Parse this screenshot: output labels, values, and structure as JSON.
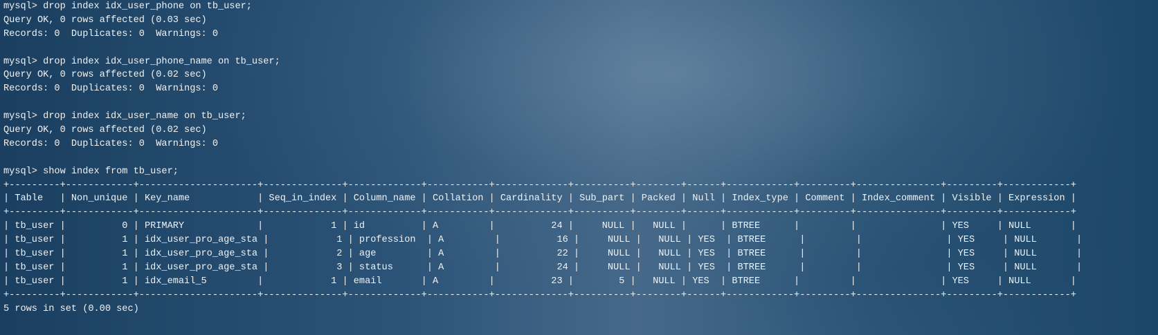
{
  "terminal": {
    "lines": [
      "mysql> drop index idx_user_phone on tb_user;",
      "Query OK, 0 rows affected (0.03 sec)",
      "Records: 0  Duplicates: 0  Warnings: 0",
      "",
      "mysql> drop index idx_user_phone_name on tb_user;",
      "Query OK, 0 rows affected (0.02 sec)",
      "Records: 0  Duplicates: 0  Warnings: 0",
      "",
      "mysql> drop index idx_user_name on tb_user;",
      "Query OK, 0 rows affected (0.02 sec)",
      "Records: 0  Duplicates: 0  Warnings: 0",
      "",
      "mysql> show index from tb_user;",
      "+---------+------------+---------------------+--------------+-------------+-----------+-------------+----------+--------+------+------------+---------+---------------+---------+------------+",
      "| Table   | Non_unique | Key_name            | Seq_in_index | Column_name | Collation | Cardinality | Sub_part | Packed | Null | Index_type | Comment | Index_comment | Visible | Expression |",
      "+---------+------------+---------------------+--------------+-------------+-----------+-------------+----------+--------+------+------------+---------+---------------+---------+------------+",
      "| tb_user |          0 | PRIMARY             |            1 | id          | A         |          24 |     NULL |   NULL |      | BTREE      |         |               | YES     | NULL       |",
      "| tb_user |          1 | idx_user_pro_age_sta |            1 | profession  | A         |          16 |     NULL |   NULL | YES  | BTREE      |         |               | YES     | NULL       |",
      "| tb_user |          1 | idx_user_pro_age_sta |            2 | age         | A         |          22 |     NULL |   NULL | YES  | BTREE      |         |               | YES     | NULL       |",
      "| tb_user |          1 | idx_user_pro_age_sta |            3 | status      | A         |          24 |     NULL |   NULL | YES  | BTREE      |         |               | YES     | NULL       |",
      "| tb_user |          1 | idx_email_5         |            1 | email       | A         |          23 |        5 |   NULL | YES  | BTREE      |         |               | YES     | NULL       |",
      "+---------+------------+---------------------+--------------+-------------+-----------+-------------+----------+--------+------+------------+---------+---------------+---------+------------+",
      "5 rows in set (0.00 sec)"
    ]
  }
}
